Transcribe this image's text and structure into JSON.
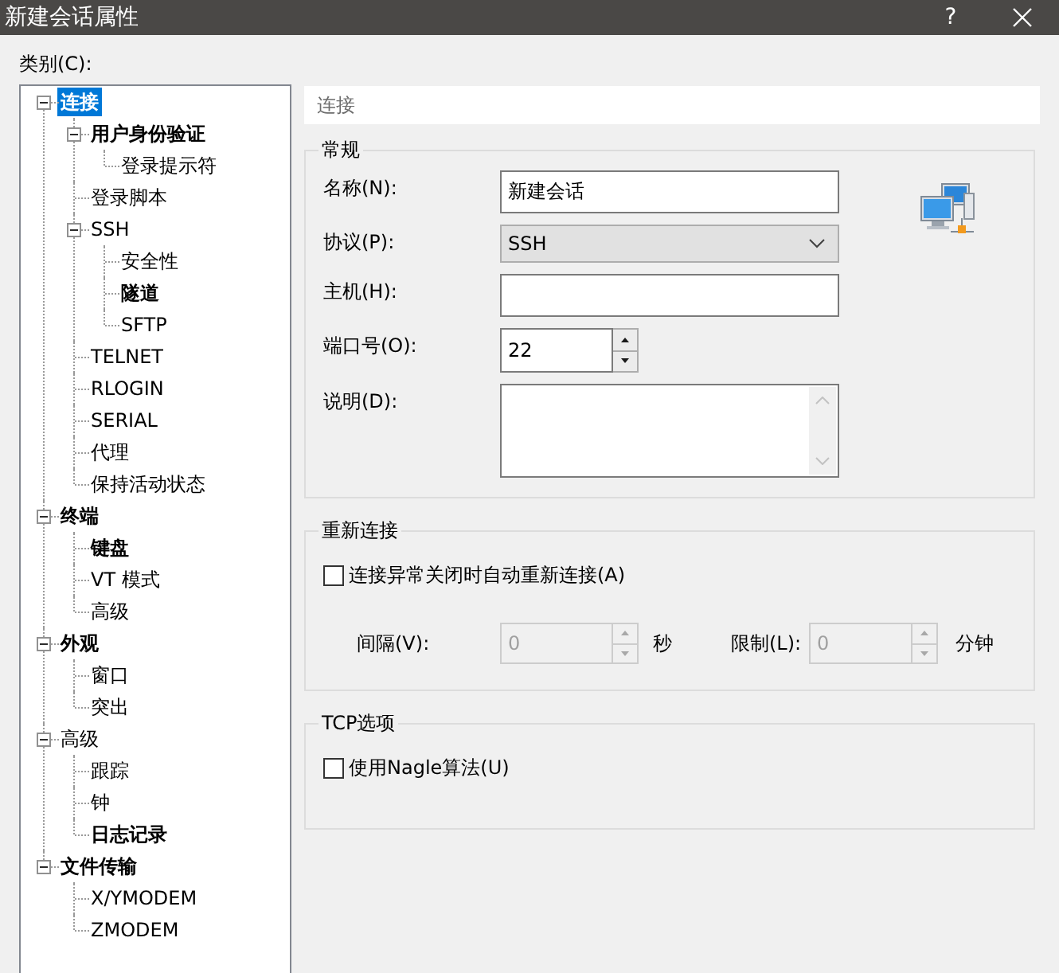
{
  "window": {
    "title": "新建会话属性",
    "help_button": "?"
  },
  "category_label": "类别(C):",
  "tree": [
    {
      "label": "连接",
      "bold": true,
      "selected": true,
      "expanded": true,
      "children": [
        {
          "label": "用户身份验证",
          "bold": true,
          "selected": false,
          "expanded": true,
          "children": [
            {
              "label": "登录提示符",
              "bold": false,
              "selected": false
            }
          ]
        },
        {
          "label": "登录脚本",
          "bold": false,
          "selected": false
        },
        {
          "label": "SSH",
          "bold": false,
          "selected": false,
          "expanded": true,
          "children": [
            {
              "label": "安全性",
              "bold": false,
              "selected": false
            },
            {
              "label": "隧道",
              "bold": true,
              "selected": false
            },
            {
              "label": "SFTP",
              "bold": false,
              "selected": false
            }
          ]
        },
        {
          "label": "TELNET",
          "bold": false,
          "selected": false
        },
        {
          "label": "RLOGIN",
          "bold": false,
          "selected": false
        },
        {
          "label": "SERIAL",
          "bold": false,
          "selected": false
        },
        {
          "label": "代理",
          "bold": false,
          "selected": false
        },
        {
          "label": "保持活动状态",
          "bold": false,
          "selected": false
        }
      ]
    },
    {
      "label": "终端",
      "bold": true,
      "selected": false,
      "expanded": true,
      "children": [
        {
          "label": "键盘",
          "bold": true,
          "selected": false
        },
        {
          "label": "VT 模式",
          "bold": false,
          "selected": false
        },
        {
          "label": "高级",
          "bold": false,
          "selected": false
        }
      ]
    },
    {
      "label": "外观",
      "bold": true,
      "selected": false,
      "expanded": true,
      "children": [
        {
          "label": "窗口",
          "bold": false,
          "selected": false
        },
        {
          "label": "突出",
          "bold": false,
          "selected": false
        }
      ]
    },
    {
      "label": "高级",
      "bold": false,
      "selected": false,
      "expanded": true,
      "children": [
        {
          "label": "跟踪",
          "bold": false,
          "selected": false
        },
        {
          "label": "钟",
          "bold": false,
          "selected": false
        },
        {
          "label": "日志记录",
          "bold": true,
          "selected": false
        }
      ]
    },
    {
      "label": "文件传输",
      "bold": true,
      "selected": false,
      "expanded": true,
      "children": [
        {
          "label": "X/YMODEM",
          "bold": false,
          "selected": false
        },
        {
          "label": "ZMODEM",
          "bold": false,
          "selected": false
        }
      ]
    }
  ],
  "page_header": "连接",
  "general": {
    "title": "常规",
    "fields": [
      {
        "kind": "text",
        "label": "名称(N):",
        "value": "新建会话"
      },
      {
        "kind": "dropdown",
        "label": "协议(P):",
        "value": "SSH"
      },
      {
        "kind": "text",
        "label": "主机(H):"
      },
      {
        "kind": "spinner",
        "label": "端口号(O):",
        "value": "22",
        "disabled": false
      },
      {
        "kind": "textarea",
        "label": "说明(D):"
      }
    ]
  },
  "reconnect": {
    "title": "重新连接",
    "checkbox": {
      "label": "连接异常关闭时自动重新连接(A)",
      "checked": false
    },
    "spinners": [
      {
        "label": "间隔(V):",
        "value": "0",
        "unit": "秒",
        "disabled": true
      },
      {
        "label": "限制(L):",
        "value": "0",
        "unit": "分钟",
        "disabled": true
      }
    ]
  },
  "tcp_options": {
    "title": "TCP选项",
    "checkbox": {
      "label": "使用Nagle算法(U)",
      "checked": false
    }
  }
}
